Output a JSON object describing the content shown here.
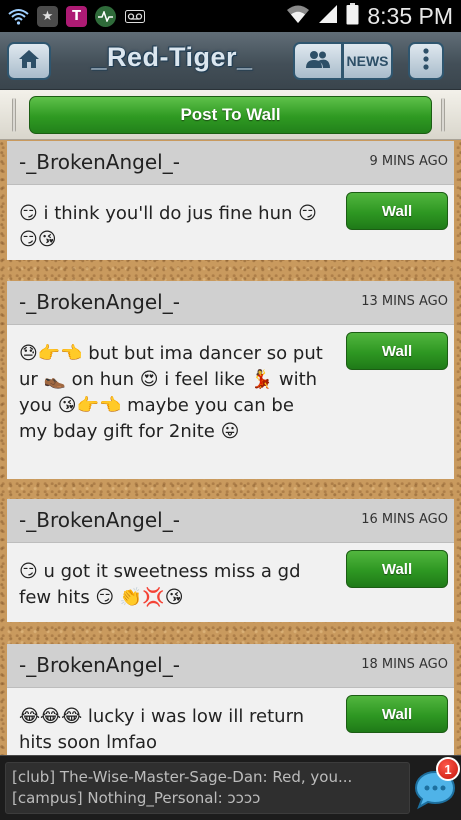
{
  "status_bar": {
    "time": "8:35 PM",
    "notification_icons": [
      "wifi-icon",
      "star-icon",
      "tmobile-icon",
      "activity-icon",
      "voicemail-icon"
    ],
    "system_icons": [
      "wifi-signal-icon",
      "cell-signal-icon",
      "battery-icon"
    ]
  },
  "header": {
    "brand": "_Red-Tiger_",
    "home_icon": "home-icon",
    "friends_icon": "friends-icon",
    "news_label": "NEWS",
    "menu_icon": "menu-dots-icon"
  },
  "post_bar": {
    "post_label": "Post To Wall"
  },
  "posts": [
    {
      "author": "-_BrokenAngel_-",
      "time": "9 MINS AGO",
      "message": "😏 i think you'll do jus fine hun 😏😏😘",
      "button_label": "Wall"
    },
    {
      "author": "-_BrokenAngel_-",
      "time": "13 MINS AGO",
      "message": "😓👉👈 but but ima dancer so put ur 👞 on hun 😍 i feel like 💃 with you 😘👉👈 maybe you can be my bday gift for 2nite 😛",
      "button_label": "Wall"
    },
    {
      "author": "-_BrokenAngel_-",
      "time": "16 MINS AGO",
      "message": "😏 u got it sweetness miss a gd few hits 😏 👏💢😘",
      "button_label": "Wall"
    },
    {
      "author": "-_BrokenAngel_-",
      "time": "18 MINS AGO",
      "message": "😂😂😂 lucky i was low ill return hits soon lmfao",
      "button_label": "Wall"
    }
  ],
  "chat_ticker": {
    "lines": [
      "[club] The-Wise-Master-Sage-Dan: Red, you...",
      "[campus] Nothing_Personal: ↄↄↄↄ"
    ],
    "unread_count": "1",
    "chat_icon": "chat-bubble-icon"
  },
  "colors": {
    "header_bg": "#434f58",
    "button_green": "#2f9a22",
    "cork": "#c99a5e",
    "badge_red": "#d9271b"
  }
}
